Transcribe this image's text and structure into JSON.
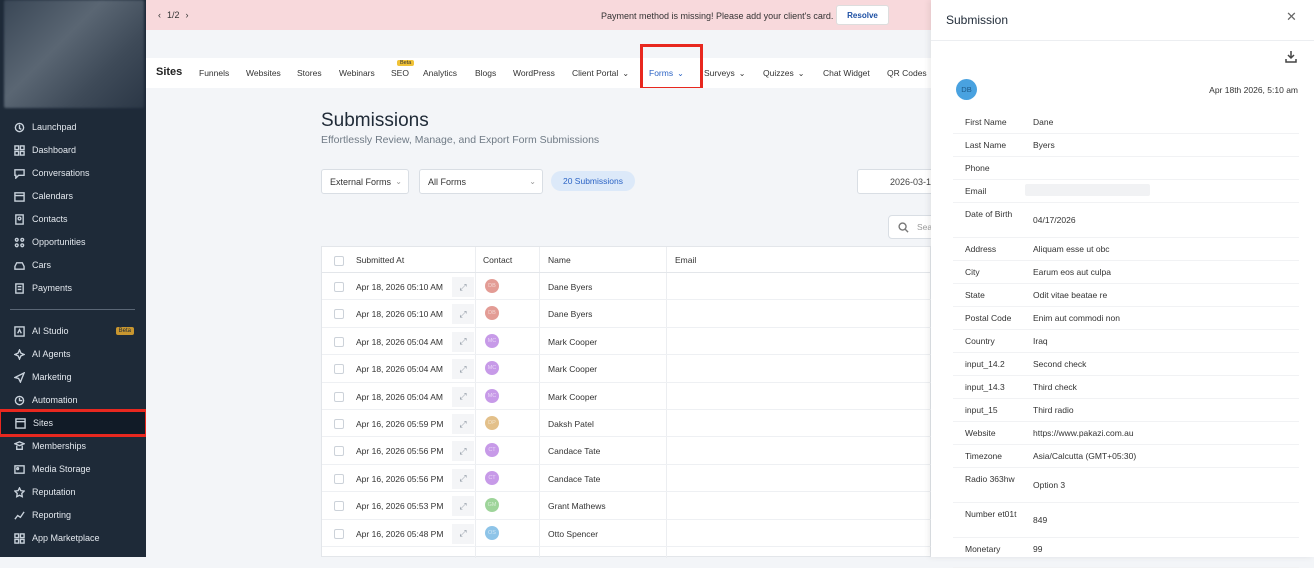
{
  "banner": {
    "pager": "1/2",
    "message": "Payment method is missing! Please add your client's card.",
    "resolve": "Resolve"
  },
  "sidebar": {
    "items": [
      {
        "label": "Launchpad",
        "icon": "rocket-icon"
      },
      {
        "label": "Dashboard",
        "icon": "dashboard-icon"
      },
      {
        "label": "Conversations",
        "icon": "chat-icon"
      },
      {
        "label": "Calendars",
        "icon": "calendar-icon"
      },
      {
        "label": "Contacts",
        "icon": "contacts-icon"
      },
      {
        "label": "Opportunities",
        "icon": "opportunities-icon"
      },
      {
        "label": "Cars",
        "icon": "car-icon"
      },
      {
        "label": "Payments",
        "icon": "payments-icon"
      },
      {
        "label": "AI Studio",
        "icon": "ai-studio-icon",
        "badge": "Beta"
      },
      {
        "label": "AI Agents",
        "icon": "ai-agents-icon"
      },
      {
        "label": "Marketing",
        "icon": "marketing-icon"
      },
      {
        "label": "Automation",
        "icon": "automation-icon"
      },
      {
        "label": "Sites",
        "icon": "sites-icon",
        "active": true
      },
      {
        "label": "Memberships",
        "icon": "memberships-icon"
      },
      {
        "label": "Media Storage",
        "icon": "media-icon"
      },
      {
        "label": "Reputation",
        "icon": "star-icon"
      },
      {
        "label": "Reporting",
        "icon": "reporting-icon"
      },
      {
        "label": "App Marketplace",
        "icon": "marketplace-icon"
      }
    ]
  },
  "topnav": {
    "title": "Sites",
    "items": [
      "Funnels",
      "Websites",
      "Stores",
      "Webinars",
      "SEO",
      "Analytics",
      "Blogs",
      "WordPress",
      "Client Portal",
      "Forms",
      "Surveys",
      "Quizzes",
      "Chat Widget",
      "QR Codes"
    ],
    "seo_badge": "Beta"
  },
  "page": {
    "title": "Submissions",
    "subtitle": "Effortlessly Review, Manage, and Export Form Submissions",
    "filter_source": "External Forms",
    "filter_forms": "All Forms",
    "count_pill": "20 Submissions",
    "date_value": "2026-03-1",
    "search_placeholder": "Sea"
  },
  "table": {
    "headers": [
      "Submitted At",
      "Contact",
      "Name",
      "Email"
    ],
    "rows": [
      {
        "date": "Apr 18, 2026 05:10 AM",
        "initials": "DB",
        "name": "Dane Byers",
        "color": "#e39c95"
      },
      {
        "date": "Apr 18, 2026 05:10 AM",
        "initials": "DB",
        "name": "Dane Byers",
        "color": "#e39c95"
      },
      {
        "date": "Apr 18, 2026 05:04 AM",
        "initials": "MC",
        "name": "Mark Cooper",
        "color": "#c79ae8"
      },
      {
        "date": "Apr 18, 2026 05:04 AM",
        "initials": "MC",
        "name": "Mark Cooper",
        "color": "#c79ae8"
      },
      {
        "date": "Apr 18, 2026 05:04 AM",
        "initials": "MC",
        "name": "Mark Cooper",
        "color": "#c79ae8"
      },
      {
        "date": "Apr 16, 2026 05:59 PM",
        "initials": "DP",
        "name": "Daksh Patel",
        "color": "#e3c08a"
      },
      {
        "date": "Apr 16, 2026 05:56 PM",
        "initials": "CT",
        "name": "Candace Tate",
        "color": "#c79ae8"
      },
      {
        "date": "Apr 16, 2026 05:56 PM",
        "initials": "CT",
        "name": "Candace Tate",
        "color": "#c79ae8"
      },
      {
        "date": "Apr 16, 2026 05:53 PM",
        "initials": "GM",
        "name": "Grant Mathews",
        "color": "#9ed49a"
      },
      {
        "date": "Apr 16, 2026 05:48 PM",
        "initials": "OS",
        "name": "Otto Spencer",
        "color": "#8ec4e8"
      }
    ]
  },
  "panel": {
    "title": "Submission",
    "avatar": "DB",
    "timestamp": "Apr 18th 2026, 5:10 am",
    "fields": [
      {
        "label": "First Name",
        "value": "Dane"
      },
      {
        "label": "Last Name",
        "value": "Byers"
      },
      {
        "label": "Phone",
        "value": ""
      },
      {
        "label": "Email",
        "value": ""
      },
      {
        "label": "Date of Birth",
        "value": "04/17/2026"
      },
      {
        "label": "Address",
        "value": "Aliquam esse ut obc"
      },
      {
        "label": "City",
        "value": "Earum eos aut culpa"
      },
      {
        "label": "State",
        "value": "Odit vitae beatae re"
      },
      {
        "label": "Postal Code",
        "value": "Enim aut commodi non"
      },
      {
        "label": "Country",
        "value": "Iraq"
      },
      {
        "label": "input_14.2",
        "value": "Second check"
      },
      {
        "label": "input_14.3",
        "value": "Third check"
      },
      {
        "label": "input_15",
        "value": "Third radio"
      },
      {
        "label": "Website",
        "value": "https://www.pakazi.com.au"
      },
      {
        "label": "Timezone",
        "value": "Asia/Calcutta (GMT+05:30)"
      },
      {
        "label": "Radio 363hw",
        "value": "Option 3"
      },
      {
        "label": "Number et01t",
        "value": "849"
      },
      {
        "label": "Monetary",
        "value": "99"
      }
    ]
  },
  "colors": {
    "sidebar_bg": "#1e2a38",
    "highlight": "#e8281f",
    "link": "#2c64c5",
    "banner_bg": "#f8d9dc"
  }
}
